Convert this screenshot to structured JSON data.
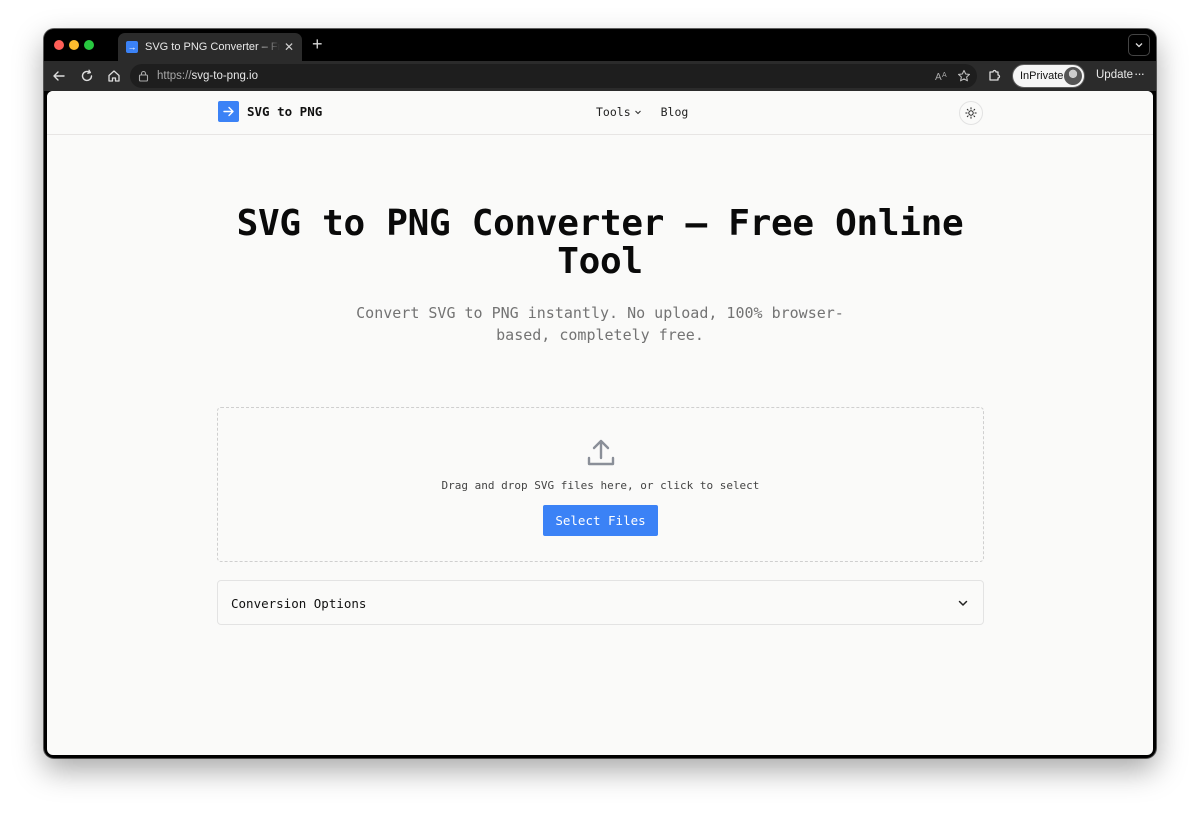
{
  "browser": {
    "tab_title": "SVG to PNG Converter – Free Online Tool",
    "tab_favicon": "→",
    "tab_close": "✕",
    "new_tab": "+",
    "url_scheme": "https://",
    "url_host": "svg-to-png.io",
    "inprivate_label": "InPrivate",
    "update_label": "Update",
    "more_label": "···"
  },
  "site": {
    "logo_text": "SVG to PNG",
    "nav": {
      "tools_label": "Tools",
      "blog_label": "Blog"
    },
    "accent_color": "#3b82f6"
  },
  "hero": {
    "title": "SVG to PNG Converter – Free Online Tool",
    "subtitle": "Convert SVG to PNG instantly. No upload, 100% browser-based, completely free."
  },
  "dropzone": {
    "instruction": "Drag and drop SVG files here, or click to select",
    "button_label": "Select Files"
  },
  "options": {
    "label": "Conversion Options"
  }
}
